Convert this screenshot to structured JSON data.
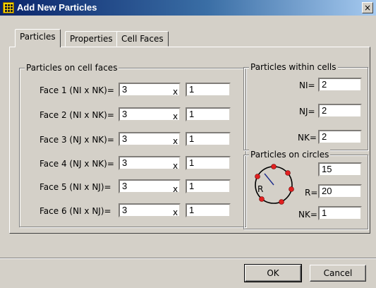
{
  "window": {
    "title": "Add New Particles",
    "close_glyph": "×"
  },
  "tabs": [
    {
      "label": "Particles",
      "active": true
    },
    {
      "label": "Properties",
      "active": false
    },
    {
      "label": "Cell Faces",
      "active": false
    }
  ],
  "cell_faces": {
    "title": "Particles on cell faces",
    "separator": "x",
    "rows": [
      {
        "label": "Face 1 (NI x NK)=",
        "first": "3",
        "second": "1"
      },
      {
        "label": "Face 2 (NI x NK)=",
        "first": "3",
        "second": "1"
      },
      {
        "label": "Face 3 (NJ x NK)=",
        "first": "3",
        "second": "1"
      },
      {
        "label": "Face 4 (NJ x NK)=",
        "first": "3",
        "second": "1"
      },
      {
        "label": "Face 5 (NI x NJ)=",
        "first": "3",
        "second": "1"
      },
      {
        "label": "Face 6 (NI x NJ)=",
        "first": "3",
        "second": "1"
      }
    ]
  },
  "within_cells": {
    "title": "Particles within cells",
    "ni_label": "NI=",
    "ni": "2",
    "nj_label": "NJ=",
    "nj": "2",
    "nk_label": "NK=",
    "nk": "2"
  },
  "circles": {
    "title": "Particles on circles",
    "count": "15",
    "r_label": "R=",
    "r": "20",
    "nk_label": "NK=",
    "nk": "1",
    "diagram_radius_label": "R"
  },
  "buttons": {
    "ok": "OK",
    "cancel": "Cancel"
  },
  "colors": {
    "title_bar": "#0a246a",
    "window": "#d4d0c8",
    "particle_dot": "#e02020",
    "radius_line": "#1a2a8a"
  }
}
